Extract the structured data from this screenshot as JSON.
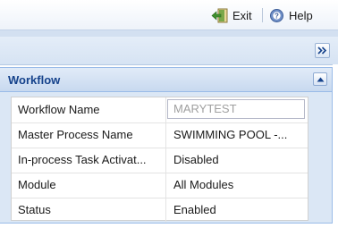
{
  "topbar": {
    "exit_label": "Exit",
    "help_label": "Help"
  },
  "toolbar": {
    "collapse_glyph": "»"
  },
  "panel": {
    "title": "Workflow"
  },
  "properties": [
    {
      "name": "Workflow Name",
      "value": "MARYTEST"
    },
    {
      "name": "Master Process Name",
      "value": "SWIMMING POOL -..."
    },
    {
      "name": "In-process Task Activat...",
      "value": "Disabled"
    },
    {
      "name": "Module",
      "value": "All Modules"
    },
    {
      "name": "Status",
      "value": "Enabled"
    }
  ],
  "colors": {
    "header_text": "#15428b",
    "panel_border": "#99bbe8"
  }
}
